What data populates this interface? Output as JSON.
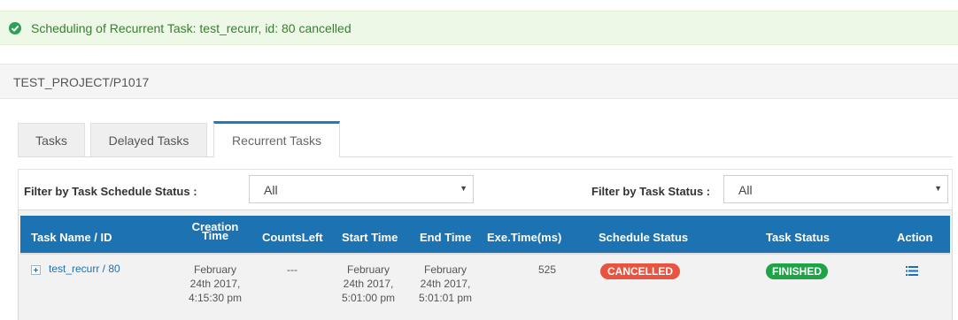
{
  "alert": {
    "message": "Scheduling of Recurrent Task: test_recurr, id: 80 cancelled",
    "icon": "check-circle-icon",
    "color": "#2e9f56"
  },
  "breadcrumb": {
    "text": "TEST_PROJECT/P1017"
  },
  "tabs": [
    {
      "label": "Tasks",
      "active": false
    },
    {
      "label": "Delayed Tasks",
      "active": false
    },
    {
      "label": "Recurrent Tasks",
      "active": true
    }
  ],
  "filters": {
    "schedule_label": "Filter by Task Schedule Status :",
    "schedule_value": "All",
    "task_label": "Filter by Task Status :",
    "task_value": "All"
  },
  "table": {
    "headers": {
      "task_name": "Task Name / ID",
      "creation_time_1": "Creation",
      "creation_time_2": "Time",
      "counts_left": "CountsLeft",
      "start_time": "Start Time",
      "end_time": "End Time",
      "exe_time": "Exe.Time(ms)",
      "schedule_status": "Schedule Status",
      "task_status": "Task Status",
      "action": "Action"
    },
    "rows": [
      {
        "task_link": "test_recurr / 80",
        "creation": [
          "February",
          "24th 2017,",
          "4:15:30 pm"
        ],
        "counts_left": "---",
        "start": [
          "February",
          "24th 2017,",
          "5:01:00 pm"
        ],
        "end": [
          "February",
          "24th 2017,",
          "5:01:01 pm"
        ],
        "exe_time": "525",
        "schedule_status": "CANCELLED",
        "task_status": "FINISHED",
        "action_icon": "list-icon"
      }
    ]
  },
  "colors": {
    "header_bg": "#1d72b1",
    "cancelled": "#e8543f",
    "finished": "#1ea347",
    "link": "#1f6fb5"
  }
}
